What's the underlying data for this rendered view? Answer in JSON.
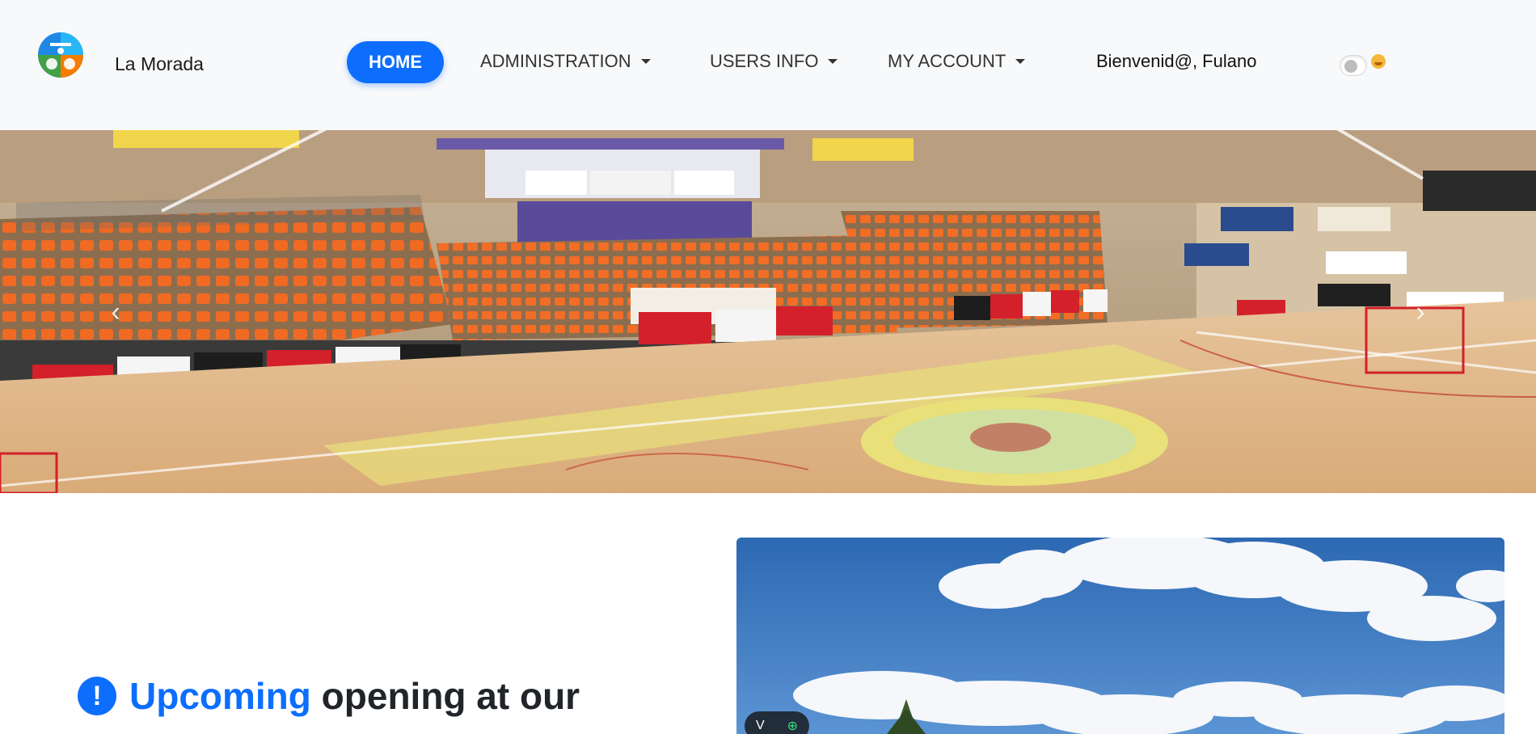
{
  "brand": {
    "name": "La Morada"
  },
  "nav": {
    "home": "HOME",
    "administration": "ADMINISTRATION",
    "users_info": "USERS INFO",
    "my_account": "MY ACCOUNT",
    "welcome": "Bienvenid@, Fulano"
  },
  "theme_toggle": {
    "enabled": false
  },
  "carousel": {
    "prev_label": "‹",
    "next_label": "›"
  },
  "section": {
    "icon": "!",
    "title_accent": "Upcoming",
    "title_rest": " opening at our"
  },
  "photo_controls": {
    "left": "V",
    "right": "⊕"
  },
  "colors": {
    "accent": "#0d6efd",
    "navbar_bg": "#f8f9fa"
  },
  "icons": {
    "logo": "sports-logo-icon",
    "dropdown": "chevron-down-icon",
    "alert": "exclamation-circle-icon"
  }
}
